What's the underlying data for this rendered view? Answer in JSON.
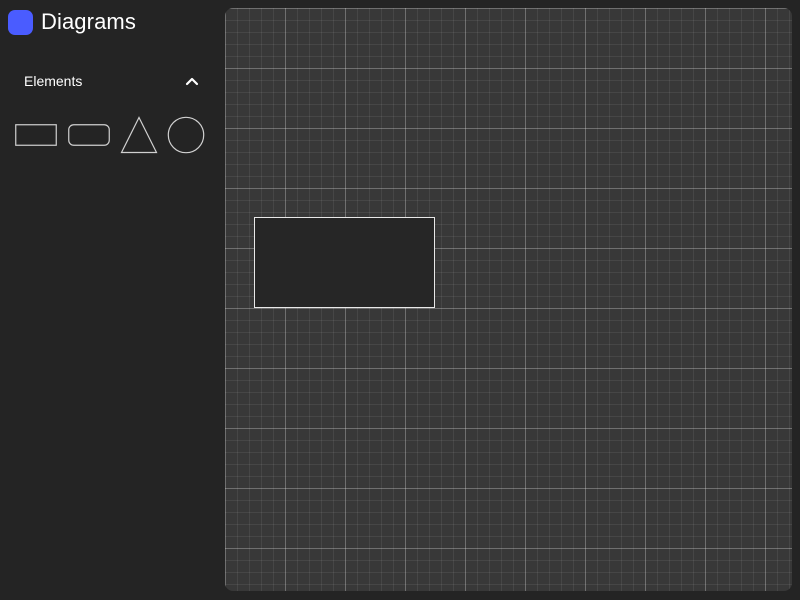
{
  "app": {
    "title": "Diagrams",
    "logo_color": "#4a5cff"
  },
  "sidebar": {
    "section": {
      "label": "Elements",
      "expanded": true,
      "toggle_icon": "chevron-up-icon"
    },
    "palette": [
      {
        "shape": "rectangle",
        "icon": "rectangle-icon"
      },
      {
        "shape": "rounded-rectangle",
        "icon": "rounded-rectangle-icon"
      },
      {
        "shape": "triangle",
        "icon": "triangle-icon"
      },
      {
        "shape": "circle",
        "icon": "circle-icon"
      }
    ]
  },
  "canvas": {
    "background_color": "#383838",
    "grid": true,
    "shapes": [
      {
        "type": "rectangle",
        "stroke": "#e8e8e8",
        "fill": "#262626"
      }
    ]
  },
  "colors": {
    "background": "#242424",
    "text": "#ffffff",
    "shape_stroke": "#d0d0d0"
  }
}
